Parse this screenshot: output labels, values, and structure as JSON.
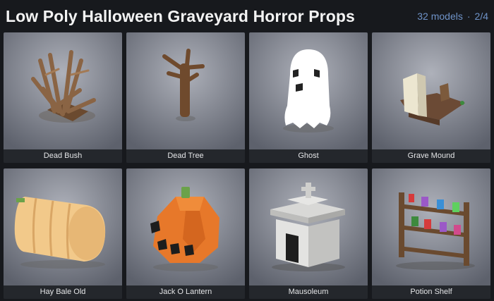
{
  "header": {
    "title": "Low Poly Halloween Graveyard Horror Props",
    "count": "32 models",
    "separator": "·",
    "page": "2/4"
  },
  "cards": [
    {
      "label": "Dead Bush",
      "icon": "dead-bush-model"
    },
    {
      "label": "Dead Tree",
      "icon": "dead-tree-model"
    },
    {
      "label": "Ghost",
      "icon": "ghost-model"
    },
    {
      "label": "Grave Mound",
      "icon": "grave-mound-model"
    },
    {
      "label": "Hay Bale Old",
      "icon": "hay-bale-model"
    },
    {
      "label": "Jack O Lantern",
      "icon": "jack-o-lantern-model"
    },
    {
      "label": "Mausoleum",
      "icon": "mausoleum-model"
    },
    {
      "label": "Potion Shelf",
      "icon": "potion-shelf-model"
    }
  ],
  "colors": {
    "background": "#17191d",
    "accent_text": "#6f93c8",
    "card": "#2a2d33"
  }
}
